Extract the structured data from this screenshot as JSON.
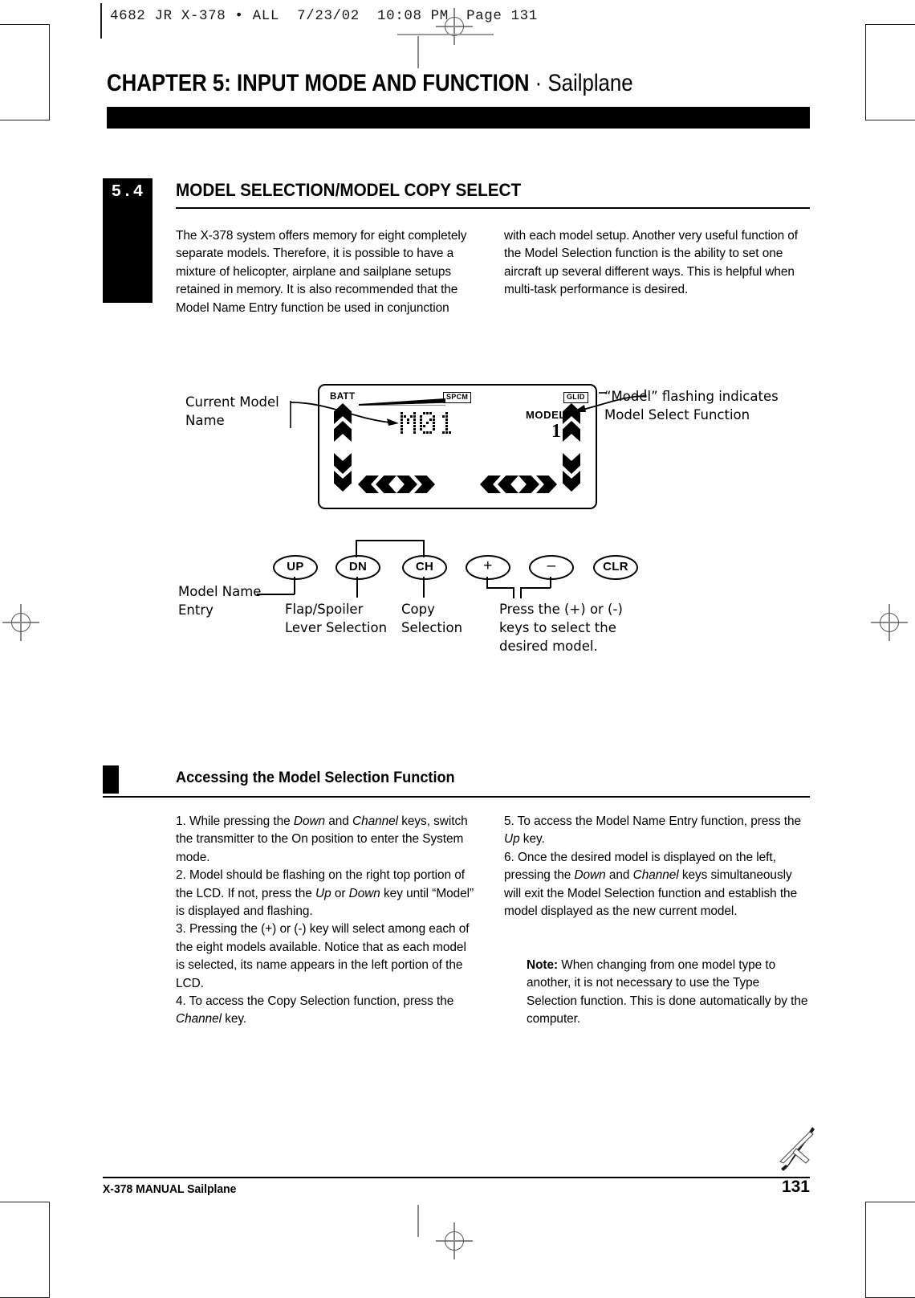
{
  "slug": "4682 JR X-378 • ALL  7/23/02  10:08 PM  Page 131",
  "chapter": {
    "title": "CHAPTER 5: INPUT MODE AND FUNCTION",
    "separator": " · ",
    "subject": "Sailplane"
  },
  "section": {
    "number": "5.4",
    "title": "MODEL SELECTION/MODEL COPY SELECT",
    "intro_left": "The X-378 system offers memory for eight completely separate models. Therefore, it is possible to have a mixture of helicopter, airplane and sailplane setups retained in memory. It is also recommended that the Model Name Entry function be used in conjunction",
    "intro_right": "with each model setup. Another very useful function of the Model Selection function is the ability to set one aircraft up several different ways. This is helpful when multi-task performance is desired."
  },
  "lcd": {
    "batt_label": "BATT",
    "spcm_label": "SPCM",
    "glid_label": "GLID",
    "model_label": "MODEL",
    "model_number": "1",
    "model_name": "M01"
  },
  "callouts": {
    "current_model_name": "Current Model Name",
    "model_flashing": "“Model” flashing indicates Model Select Function",
    "model_name_entry": "Model Name Entry",
    "flap_spoiler": "Flap/Spoiler Lever Selection",
    "copy_selection": "Copy Selection",
    "press_keys": "Press the (+) or (-) keys to select the desired model."
  },
  "buttons": [
    {
      "label": "UP",
      "name": "up-button"
    },
    {
      "label": "DN",
      "name": "dn-button"
    },
    {
      "label": "CH",
      "name": "ch-button"
    },
    {
      "label": "+",
      "name": "plus-button"
    },
    {
      "label": "–",
      "name": "minus-button"
    },
    {
      "label": "CLR",
      "name": "clr-button"
    }
  ],
  "subsection": {
    "title": "Accessing the Model Selection Function",
    "steps_left": [
      "1. While pressing the <i>Down</i> and <i>Channel</i> keys, switch the transmitter to the On position to enter the System mode.",
      "2. Model should be flashing on the right top portion of the LCD. If not, press the <i>Up</i> or <i>Down</i> key until “Model” is displayed and flashing.",
      "3. Pressing the (+) or (-) key will select among each of the eight models available. Notice that as each model is selected, its name appears in the left portion of the LCD.",
      "4. To access the Copy Selection function, press the <i>Channel</i> key."
    ],
    "steps_right": [
      "5. To access the Model Name Entry function, press the <i>Up</i> key.",
      "6. Once the desired model is displayed on the left, pressing the <i>Down</i> and <i>Channel</i> keys simultaneously will exit the Model Selection function and establish the model displayed as the new current model."
    ],
    "note": "<b>Note:</b> When changing from one model type to another, it is not necessary to use the Type Selection function. This is done automatically by the computer."
  },
  "footer": {
    "left": "X-378 MANUAL  Sailplane",
    "page": "131"
  }
}
